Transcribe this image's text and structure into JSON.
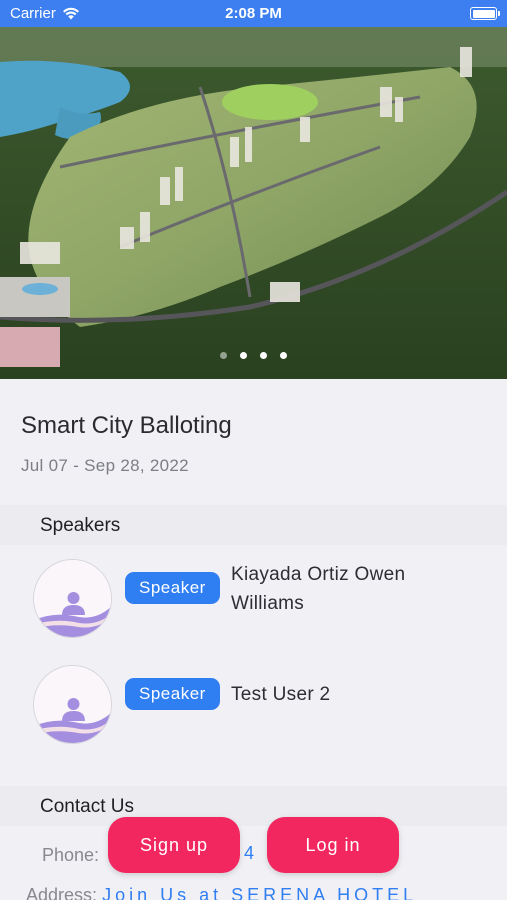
{
  "status_bar": {
    "carrier": "Carrier",
    "time": "2:08 PM",
    "wifi_icon": "wifi-icon",
    "battery_icon": "battery-icon"
  },
  "hero": {
    "image_subject": "aerial rendering of smart city development",
    "carousel": {
      "page_count": 4,
      "current_index": 0
    }
  },
  "event": {
    "title": "Smart City Balloting",
    "dates": "Jul 07 - Sep 28, 2022"
  },
  "speakers_section": {
    "title": "Speakers",
    "items": [
      {
        "role": "Speaker",
        "name": "Kiayada Ortiz Owen Williams"
      },
      {
        "role": "Speaker",
        "name": "Test User 2"
      }
    ]
  },
  "contact_section": {
    "title": "Contact Us",
    "phone_label": "Phone:",
    "phone_value": "4 4",
    "address_label": "Address:",
    "address_value": "Join Us at SERENA HOTEL"
  },
  "actions": {
    "signup_label": "Sign up",
    "login_label": "Log in"
  },
  "colors": {
    "status_bar": "#3d7ff0",
    "badge": "#2f7ef2",
    "cta": "#f2275f",
    "background": "#f0f0f5"
  }
}
